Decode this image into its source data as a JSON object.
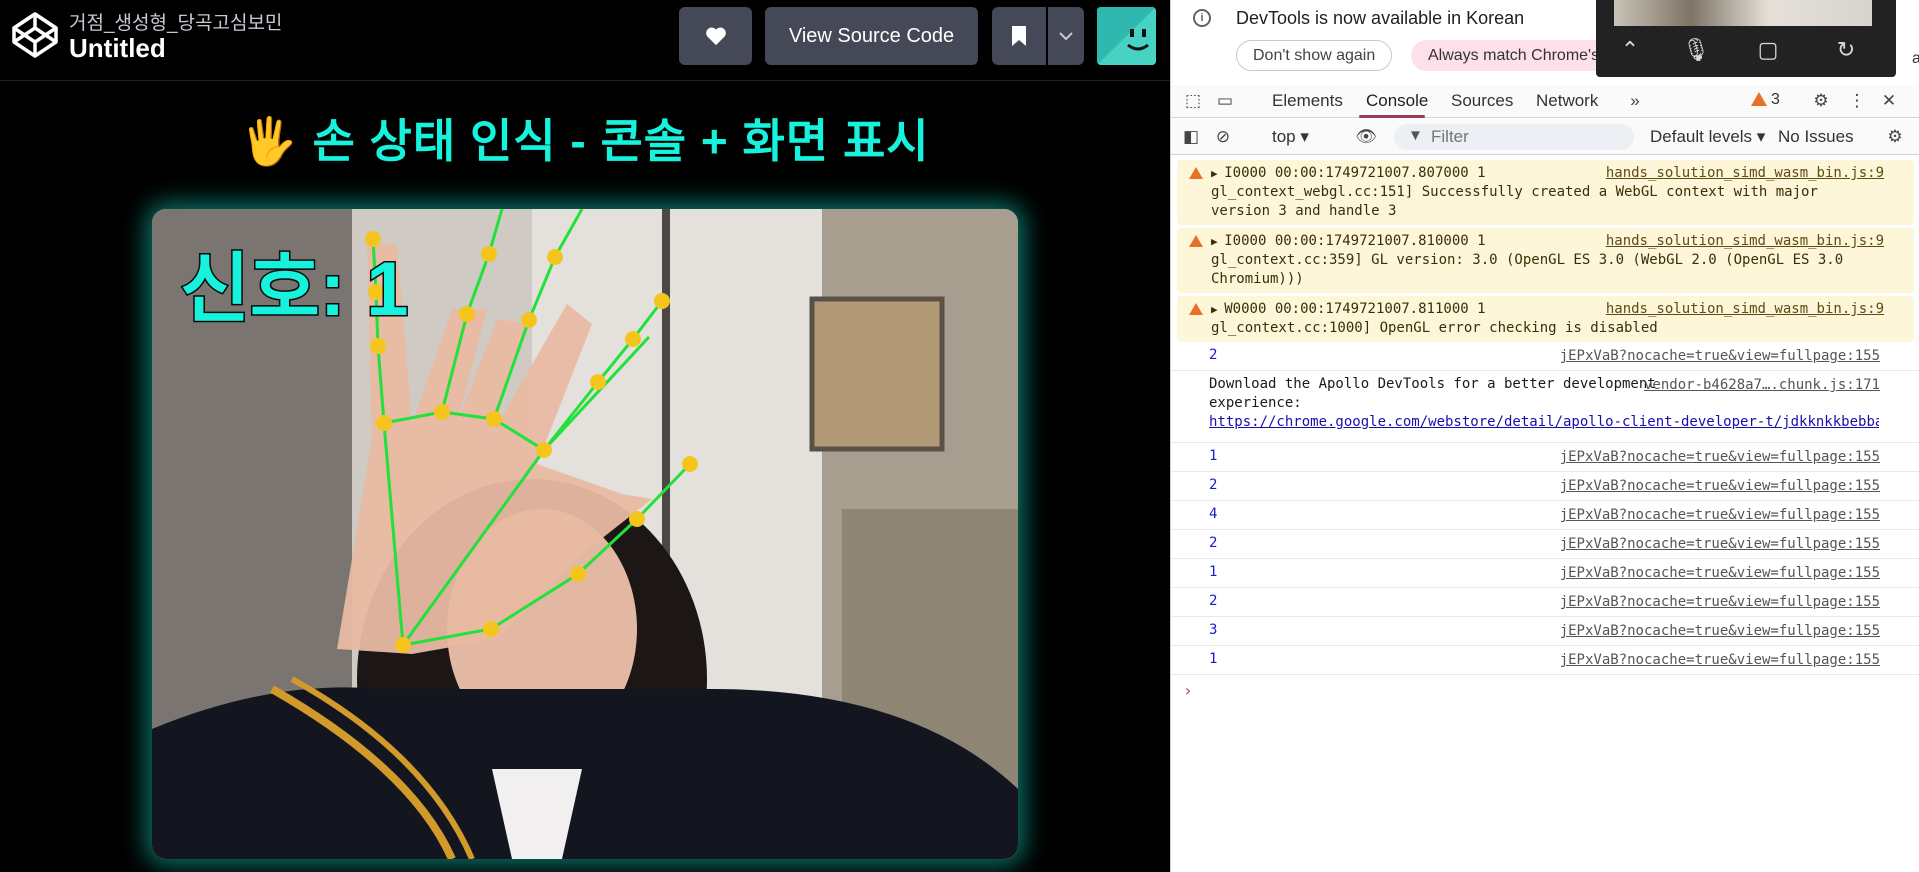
{
  "codepen": {
    "user": "거점_생성형_당곡고심보민",
    "pen_title": "Untitled",
    "view_source_label": "View Source Code"
  },
  "app": {
    "title_emoji": "🖐",
    "title": "손 상태 인식 - 콘솔 + 화면 표시",
    "signal_text": "신호: 1"
  },
  "devtools": {
    "notice": {
      "message": "DevTools is now available in Korean",
      "dont_show": "Don't show again",
      "match_language": "Always match Chrome's",
      "switch_label": "an"
    },
    "tabs": [
      "Elements",
      "Console",
      "Sources",
      "Network"
    ],
    "active_tab": "Console",
    "warning_count": "3",
    "context": "top",
    "filter_placeholder": "Filter",
    "levels": "Default levels",
    "issues": "No Issues",
    "warnings": [
      {
        "text1": "I0000 00:00:1749721007.807000     1",
        "source": "hands_solution_simd_wasm_bin.js:9",
        "text2": "gl_context_webgl.cc:151] Successfully created a WebGL context with major version 3 and handle 3"
      },
      {
        "text1": "I0000 00:00:1749721007.810000     1",
        "source": "hands_solution_simd_wasm_bin.js:9",
        "text2": "gl_context.cc:359] GL version: 3.0 (OpenGL ES 3.0 (WebGL 2.0 (OpenGL ES 3.0 Chromium)))"
      },
      {
        "text1": "W0000 00:00:1749721007.811000     1",
        "source": "hands_solution_simd_wasm_bin.js:9",
        "text2": "gl_context.cc:1000] OpenGL error checking is disabled"
      }
    ],
    "log_source": "jEPxVaB?nocache=true&view=fullpage:155",
    "first_value": "2",
    "apollo": {
      "text": "Download the Apollo DevTools for a better development experience:",
      "source": "vendor-b4628a7….chunk.js:171",
      "link": "https://chrome.google.com/webstore/detail/apollo-client-developer-t/jdkknkkbebbapi…"
    },
    "values": [
      "1",
      "2",
      "4",
      "2",
      "1",
      "2",
      "3",
      "1"
    ],
    "prompt": "›"
  }
}
